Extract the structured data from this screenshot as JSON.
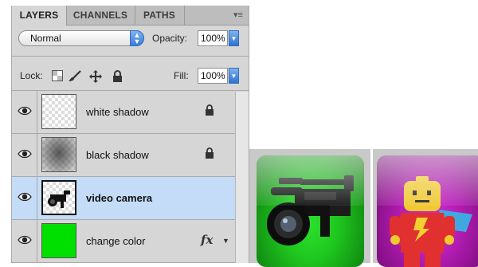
{
  "tabs": [
    {
      "label": "LAYERS",
      "active": true
    },
    {
      "label": "CHANNELS",
      "active": false
    },
    {
      "label": "PATHS",
      "active": false
    }
  ],
  "panel_menu_icon": "panel-menu-icon",
  "blend_mode": "Normal",
  "opacity": {
    "label": "Opacity:",
    "value": "100%"
  },
  "lock": {
    "label": "Lock:"
  },
  "fill": {
    "label": "Fill:",
    "value": "100%"
  },
  "layers": [
    {
      "name": "white shadow",
      "visible": true,
      "locked": true,
      "selected": false
    },
    {
      "name": "black shadow",
      "visible": true,
      "locked": true,
      "selected": false
    },
    {
      "name": "video camera",
      "visible": true,
      "locked": false,
      "selected": true
    },
    {
      "name": "change color",
      "visible": true,
      "locked": false,
      "selected": false,
      "fx": "fx"
    }
  ],
  "colors": {
    "selected_row": "#c5dcf8",
    "green_fill": "#00e000",
    "green_tile": "#1fc81f",
    "purple_tile": "#b31cb3"
  }
}
